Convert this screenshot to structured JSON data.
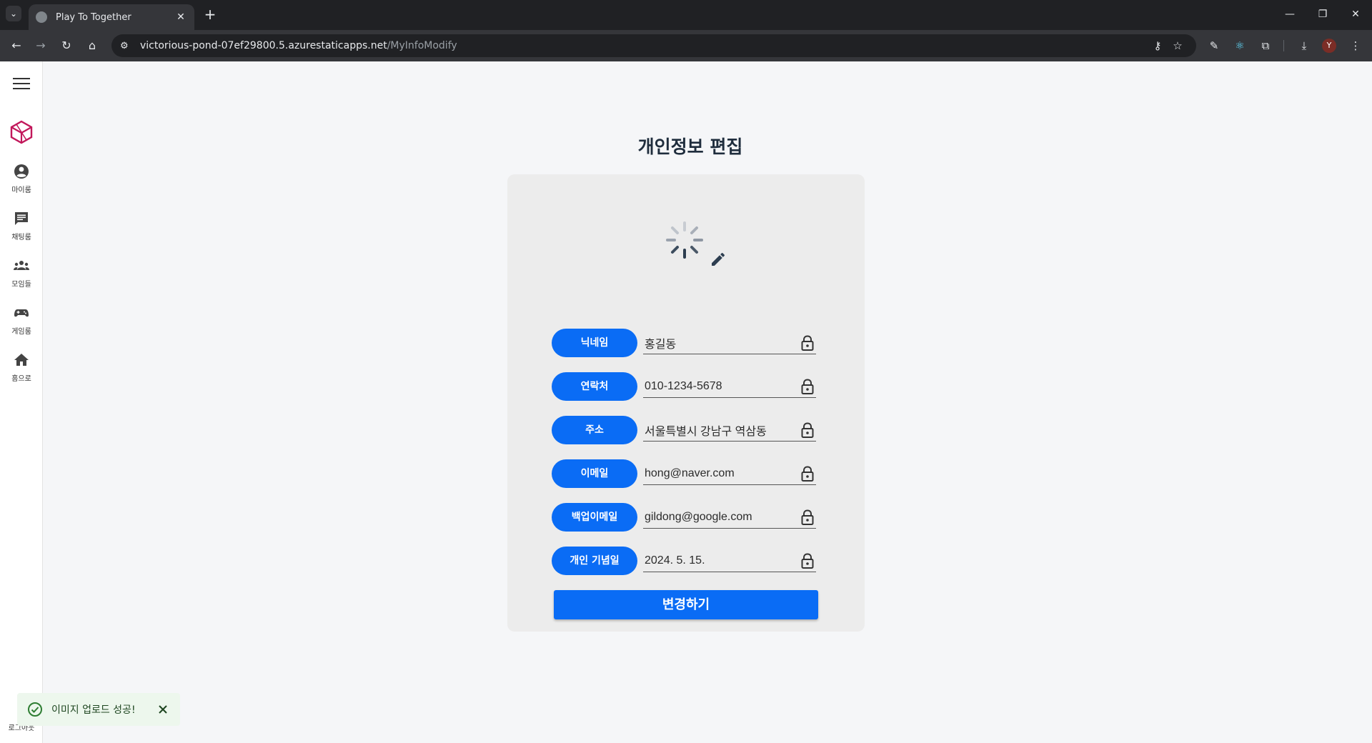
{
  "browser": {
    "tab_title": "Play To Together",
    "url_host": "victorious-pond-07ef29800.5.azurestaticapps.net",
    "url_path": "/MyInfoModify",
    "profile_initial": "Y"
  },
  "sidebar": {
    "items": [
      {
        "label": "마이룸",
        "icon": "account-circle-icon"
      },
      {
        "label": "채팅룸",
        "icon": "chat-icon"
      },
      {
        "label": "모임들",
        "icon": "groups-icon"
      },
      {
        "label": "게임룸",
        "icon": "gamepad-icon"
      },
      {
        "label": "홈으로",
        "icon": "home-icon"
      }
    ],
    "logout_label": "로그아웃"
  },
  "page": {
    "title": "개인정보 편집"
  },
  "form": {
    "fields": [
      {
        "label": "닉네임",
        "value": "홍길동"
      },
      {
        "label": "연락처",
        "value": "010-1234-5678"
      },
      {
        "label": "주소",
        "value": "서울특별시 강남구 역삼동"
      },
      {
        "label": "이메일",
        "value": "hong@naver.com"
      },
      {
        "label": "백업이메일",
        "value": "gildong@google.com"
      },
      {
        "label": "개인 기념일",
        "value": "2024. 5. 15."
      }
    ],
    "submit_label": "변경하기"
  },
  "toast": {
    "message": "이미지 업로드 성공!"
  },
  "colors": {
    "primary": "#0a6cf5",
    "sidebar_bg": "#ffffff",
    "page_bg": "#f5f6f8",
    "card_bg": "#ececec",
    "toast_bg": "#edf7ed",
    "toast_icon": "#2e7d32",
    "logo": "#c2185b"
  }
}
